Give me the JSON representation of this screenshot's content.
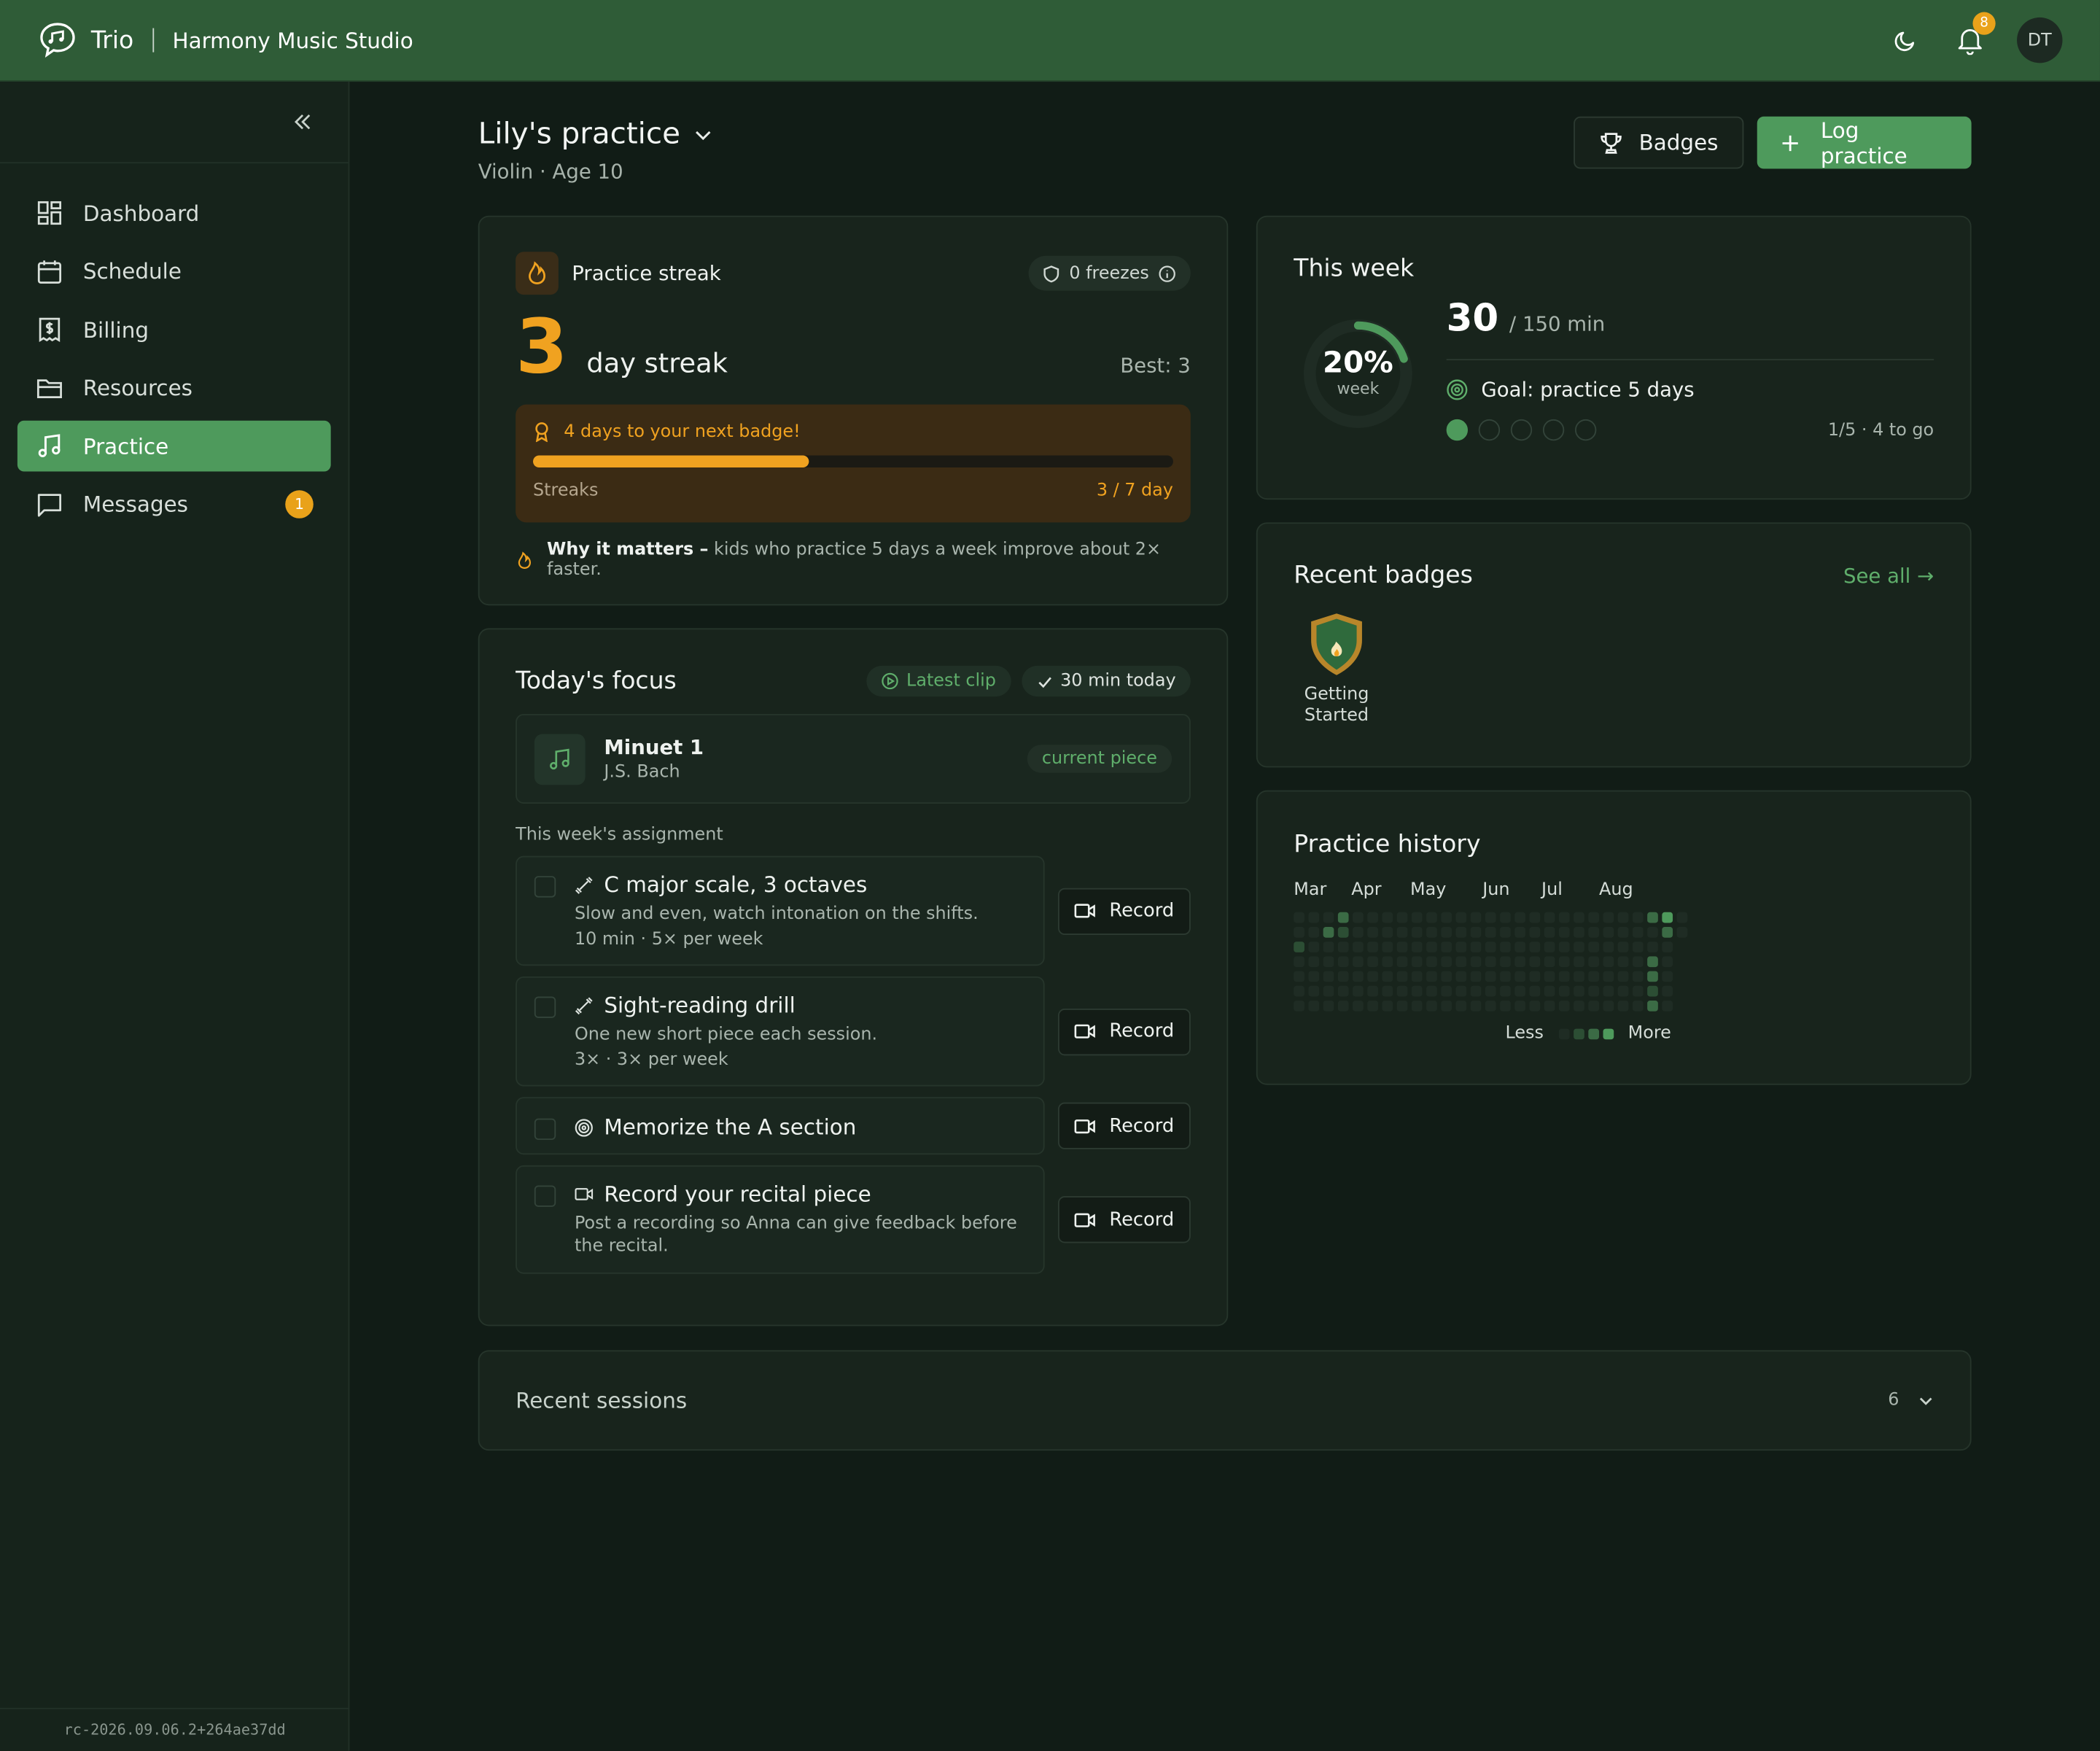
{
  "header": {
    "app_name": "Trio",
    "studio_name": "Harmony Music Studio",
    "notification_count": "8",
    "avatar_initials": "DT"
  },
  "sidebar": {
    "items": [
      {
        "label": "Dashboard",
        "icon": "dashboard-icon"
      },
      {
        "label": "Schedule",
        "icon": "calendar-icon"
      },
      {
        "label": "Billing",
        "icon": "receipt-icon"
      },
      {
        "label": "Resources",
        "icon": "folder-icon"
      },
      {
        "label": "Practice",
        "icon": "music-note-icon",
        "active": true
      },
      {
        "label": "Messages",
        "icon": "message-icon",
        "badge": "1"
      }
    ],
    "version": "rc-2026.09.06.2+264ae37dd"
  },
  "page": {
    "title": "Lily's practice",
    "subtitle": "Violin · Age 10",
    "badges_button": "Badges",
    "log_button": "Log practice"
  },
  "streak": {
    "title": "Practice streak",
    "freezes": "0 freezes",
    "days": "3",
    "label": "day streak",
    "best": "Best: 3",
    "next_badge": "4 days to your next badge!",
    "progress": 0.43,
    "progress_label": "Streaks",
    "progress_value": "3 / 7 day",
    "why_bold": "Why it matters –",
    "why_text": " kids who practice 5 days a week improve about 2× faster."
  },
  "focus": {
    "title": "Today's focus",
    "latest_clip": "Latest clip",
    "minutes_today": "30 min today",
    "piece_name": "Minuet 1",
    "piece_composer": "J.S. Bach",
    "piece_tag": "current piece",
    "assignment_label": "This week's assignment",
    "record_label": "Record",
    "tasks": [
      {
        "title": "C major scale, 3 octaves",
        "desc": "Slow and even, watch intonation on the shifts.",
        "meta": "10 min · 5× per week",
        "icon": "dumbbell-icon"
      },
      {
        "title": "Sight-reading drill",
        "desc": "One new short piece each session.",
        "meta": "3× · 3× per week",
        "icon": "dumbbell-icon"
      },
      {
        "title": "Memorize the A section",
        "desc": "",
        "meta": "",
        "icon": "target-icon"
      },
      {
        "title": "Record your recital piece",
        "desc": "Post a recording so Anna can give feedback before the recital.",
        "meta": "",
        "icon": "video-icon"
      }
    ]
  },
  "week": {
    "title": "This week",
    "percent": "20%",
    "percent_value": 0.2,
    "ring_label": "week",
    "minutes": "30",
    "minutes_of": "/ 150 min",
    "goal": "Goal: practice 5 days",
    "days_done": 1,
    "days_total": 5,
    "count_text": "1/5 · 4 to go"
  },
  "badges": {
    "title": "Recent badges",
    "see_all": "See all →",
    "items": [
      {
        "name": "Getting Started",
        "icon": "shield-flame-icon"
      }
    ]
  },
  "history": {
    "title": "Practice history",
    "months": [
      "Mar",
      "Apr",
      "May",
      "Jun",
      "Jul",
      "Aug"
    ],
    "legend_less": "Less",
    "legend_more": "More",
    "active_cells": [
      [
        3,
        0,
        2
      ],
      [
        2,
        1,
        2
      ],
      [
        3,
        1,
        1
      ],
      [
        0,
        2,
        1
      ],
      [
        24,
        0,
        2
      ],
      [
        25,
        0,
        3
      ],
      [
        25,
        1,
        2
      ],
      [
        24,
        3,
        2
      ],
      [
        24,
        4,
        2
      ],
      [
        24,
        5,
        1
      ],
      [
        24,
        6,
        2
      ]
    ]
  },
  "sessions": {
    "title": "Recent sessions",
    "count": "6"
  },
  "colors": {
    "brand_green": "#2f5c37",
    "accent_green": "#4e9a5c",
    "accent_orange": "#f0a220"
  }
}
